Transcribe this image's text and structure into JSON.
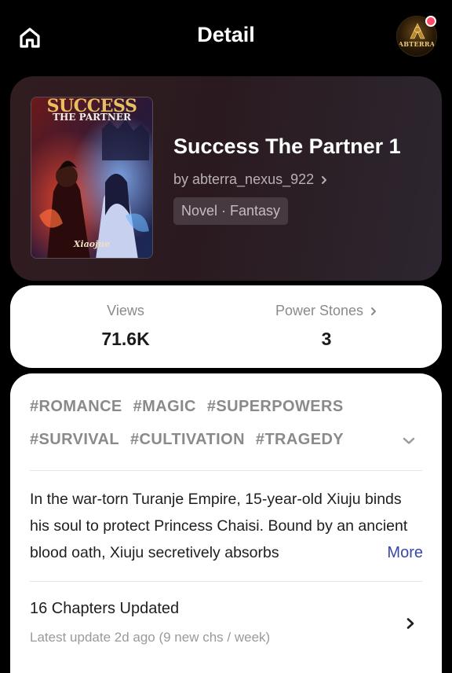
{
  "header": {
    "title": "Detail",
    "home_icon": "home-icon",
    "avatar_text": "ABTERRA",
    "has_notification": true
  },
  "book": {
    "cover_title_line1": "SUCCESS",
    "cover_title_line2": "THE PARTNER",
    "cover_signature": "Xiaojue",
    "title": "Success The Partner 1",
    "author": "by abterra_nexus_922",
    "genre": "Novel · Fantasy"
  },
  "stats": {
    "views_label": "Views",
    "views_value": "71.6K",
    "power_stones_label": "Power Stones",
    "power_stones_value": "3"
  },
  "tags": [
    "#ROMANCE",
    "#MAGIC",
    "#SUPERPOWERS",
    "#SURVIVAL",
    "#CULTIVATION",
    "#TRAGEDY"
  ],
  "synopsis": {
    "text": "In the war-torn Turanje Empire, 15-year-old Xiuju binds his soul to protect Princess Chaisi. Bound by an ancient blood oath, Xiuju secretively absorbs",
    "more_label": "More"
  },
  "chapters": {
    "title": "16 Chapters Updated",
    "subtitle": "Latest update 2d ago (9 new chs / week)"
  },
  "colors": {
    "background": "#000000",
    "book_card": "#2d1d22",
    "link": "#3a47a8",
    "notification": "#ff4a6a"
  }
}
